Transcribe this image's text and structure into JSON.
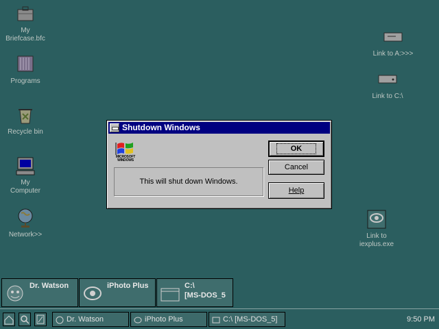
{
  "desktop": {
    "icons_left": [
      {
        "label_line1": "My",
        "label_line2": "Briefcase.bfc",
        "icon": "briefcase-icon"
      },
      {
        "label_line1": "Programs",
        "label_line2": "",
        "icon": "programs-icon"
      },
      {
        "label_line1": "Recycle bin",
        "label_line2": "",
        "icon": "recycle-bin-icon"
      },
      {
        "label_line1": "My",
        "label_line2": "Computer",
        "icon": "computer-icon"
      },
      {
        "label_line1": "Network>>",
        "label_line2": "",
        "icon": "globe-icon"
      }
    ],
    "icons_right": [
      {
        "label_line1": "Link to A:>>>",
        "label_line2": "",
        "icon": "floppy-drive-icon"
      },
      {
        "label_line1": "Link to C:\\",
        "label_line2": "",
        "icon": "hard-drive-icon"
      },
      {
        "label_line1": "Link to",
        "label_line2": "iexplus.exe",
        "icon": "link-program-icon"
      }
    ]
  },
  "dialog": {
    "title": "Shutdown Windows",
    "logo_text": "MICROSOFT WINDOWS",
    "message": "This will shut down Windows.",
    "ok_label": "OK",
    "cancel_label": "Cancel",
    "help_label": "Help"
  },
  "tray": [
    {
      "line1": "Dr. Watson",
      "line2": "",
      "icon": "dr-watson-icon"
    },
    {
      "line1": "iPhoto Plus",
      "line2": "",
      "icon": "iphoto-icon"
    },
    {
      "line1": "C:\\",
      "line2": "[MS-DOS_5",
      "icon": "dos-window-icon"
    }
  ],
  "taskbar": {
    "tools": [
      "start-icon",
      "search-icon",
      "edit-icon"
    ],
    "tasks": [
      {
        "label": "Dr. Watson",
        "icon": "dr-watson-icon"
      },
      {
        "label": "iPhoto Plus",
        "icon": "iphoto-icon"
      },
      {
        "label": "C:\\ [MS-DOS_5]",
        "icon": "dos-window-icon"
      }
    ],
    "clock": "9:50 PM"
  },
  "colors": {
    "desktop": "#2b5e5f",
    "titlebar": "#000080",
    "dialog_face": "#c0c0c0"
  }
}
